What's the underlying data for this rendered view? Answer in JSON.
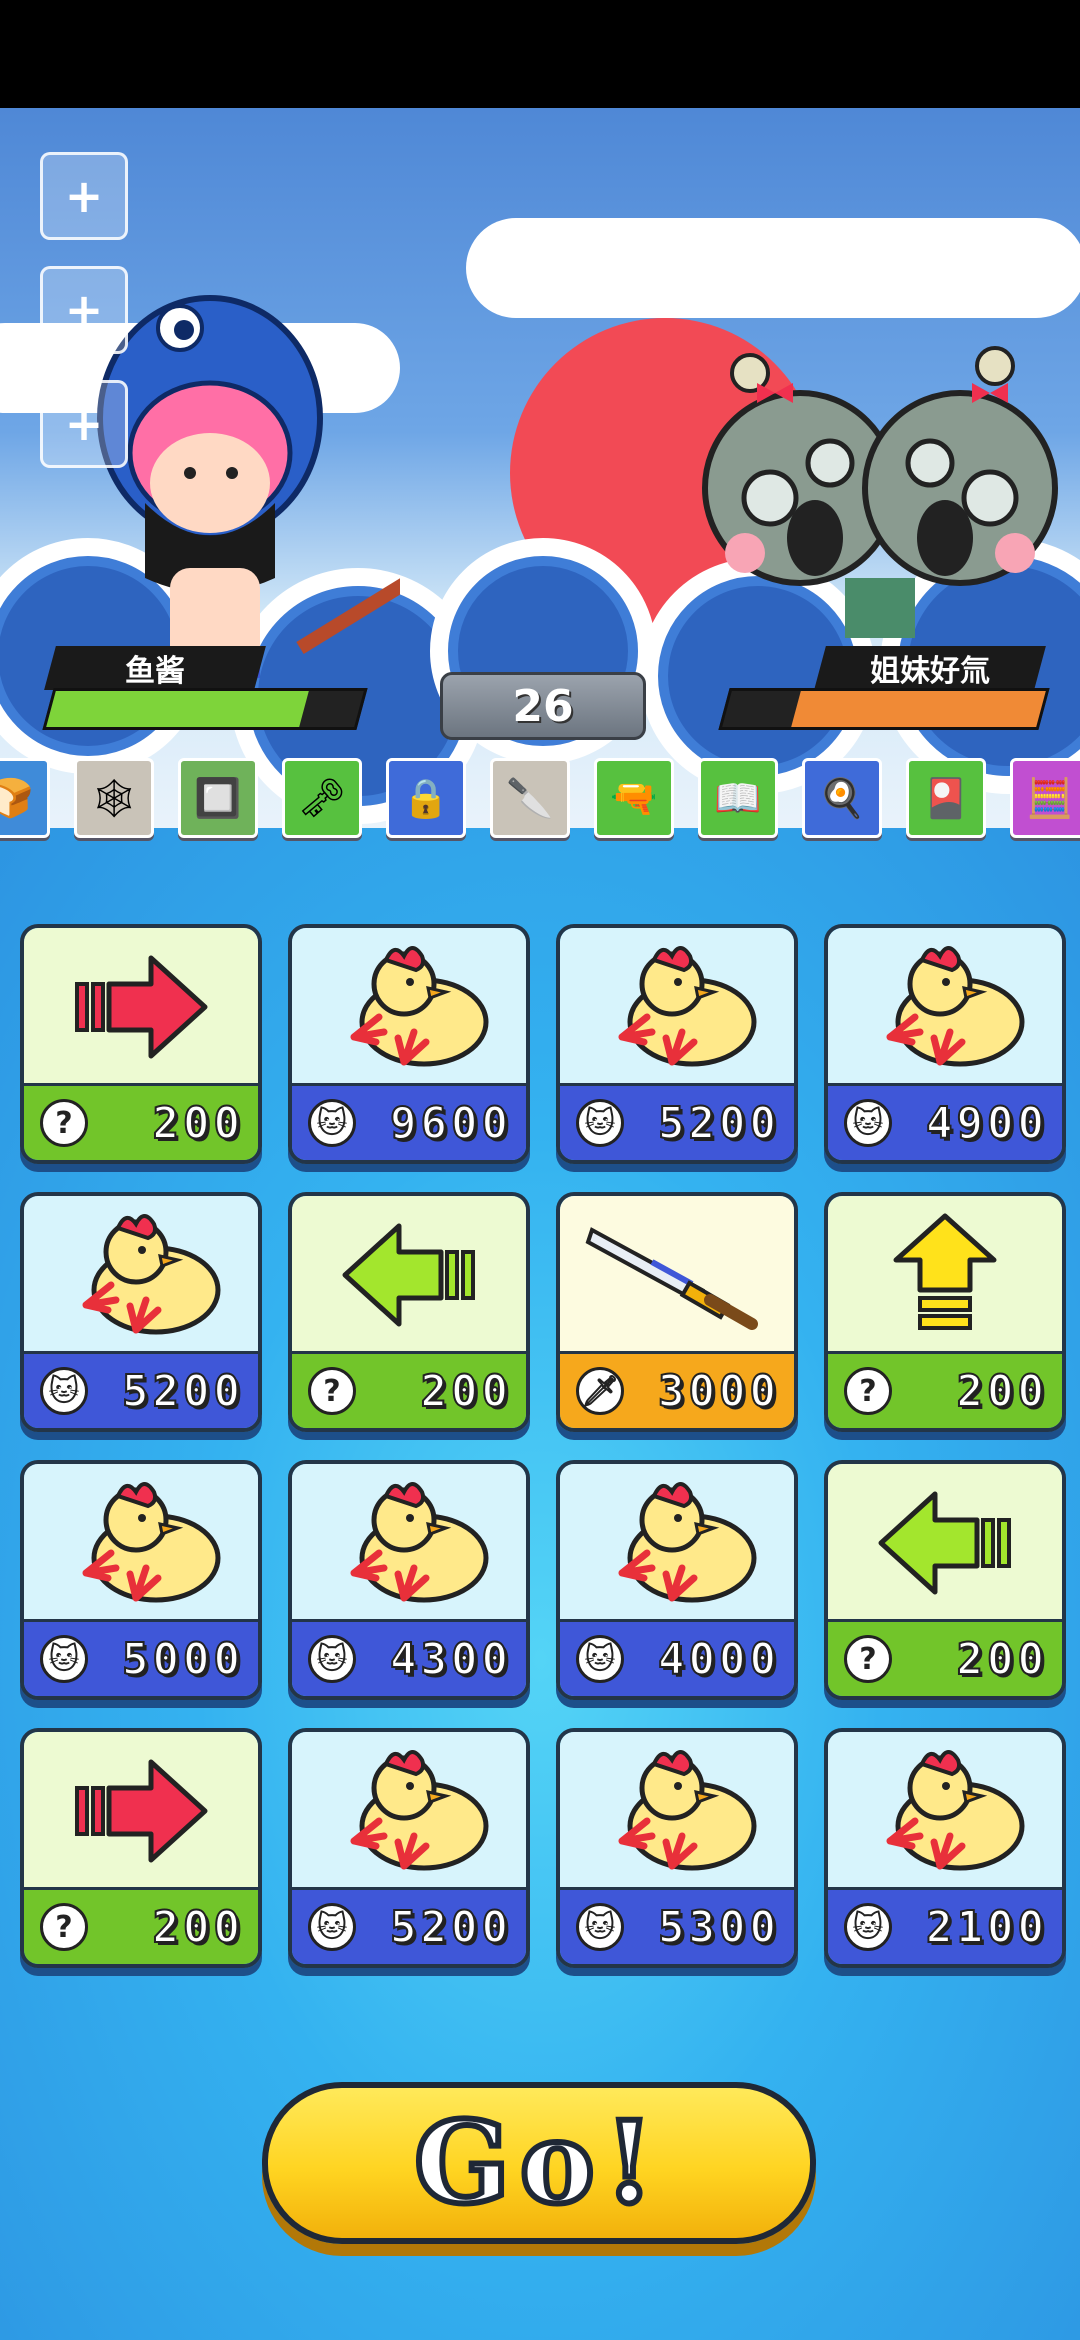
{
  "player": {
    "name": "鱼酱",
    "hp_fraction": 0.82
  },
  "enemy": {
    "name": "姐妹好氚",
    "hp_fraction": 0.78
  },
  "round": "26",
  "side_buttons": [
    "+",
    "+",
    "+"
  ],
  "item_strip": [
    {
      "icon": "bread-icon",
      "glyph": "🍞",
      "color": "#3f8bd9"
    },
    {
      "icon": "net-icon",
      "glyph": "🕸",
      "color": "#c9c3b8"
    },
    {
      "icon": "circuit-board-icon",
      "glyph": "🔲",
      "color": "#6fb25a"
    },
    {
      "icon": "key-icon",
      "glyph": "🗝",
      "color": "#57c13f"
    },
    {
      "icon": "safe-icon",
      "glyph": "🔒",
      "color": "#3f6bd9"
    },
    {
      "icon": "cleaver-icon",
      "glyph": "🔪",
      "color": "#c9c3b8"
    },
    {
      "icon": "gun-icon",
      "glyph": "🔫",
      "color": "#57c13f"
    },
    {
      "icon": "book-icon",
      "glyph": "📖",
      "color": "#57c13f"
    },
    {
      "icon": "frying-pan-icon",
      "glyph": "🍳",
      "color": "#3f6bd9"
    },
    {
      "icon": "card-icon",
      "glyph": "🎴",
      "color": "#57c13f"
    },
    {
      "icon": "calculator-icon",
      "glyph": "🧮",
      "color": "#c14fd1"
    }
  ],
  "cards": [
    {
      "type": "arrow-right",
      "theme": "green",
      "cost_icon": "?",
      "value": "200"
    },
    {
      "type": "chicken",
      "theme": "blue",
      "cost_icon": "cat",
      "value": "9600"
    },
    {
      "type": "chicken",
      "theme": "blue",
      "cost_icon": "cat",
      "value": "5200"
    },
    {
      "type": "chicken",
      "theme": "blue",
      "cost_icon": "cat",
      "value": "4900"
    },
    {
      "type": "chicken",
      "theme": "blue",
      "cost_icon": "cat",
      "value": "5200"
    },
    {
      "type": "arrow-left",
      "theme": "green",
      "cost_icon": "?",
      "value": "200"
    },
    {
      "type": "sword",
      "theme": "gold",
      "cost_icon": "sword",
      "value": "3000"
    },
    {
      "type": "arrow-up",
      "theme": "green",
      "cost_icon": "?",
      "value": "200"
    },
    {
      "type": "chicken",
      "theme": "blue",
      "cost_icon": "cat",
      "value": "5000"
    },
    {
      "type": "chicken",
      "theme": "blue",
      "cost_icon": "cat",
      "value": "4300"
    },
    {
      "type": "chicken",
      "theme": "blue",
      "cost_icon": "cat",
      "value": "4000"
    },
    {
      "type": "arrow-left",
      "theme": "green",
      "cost_icon": "?",
      "value": "200"
    },
    {
      "type": "arrow-right",
      "theme": "green",
      "cost_icon": "?",
      "value": "200"
    },
    {
      "type": "chicken",
      "theme": "blue",
      "cost_icon": "cat",
      "value": "5200"
    },
    {
      "type": "chicken",
      "theme": "blue",
      "cost_icon": "cat",
      "value": "5300"
    },
    {
      "type": "chicken",
      "theme": "blue",
      "cost_icon": "cat",
      "value": "2100"
    }
  ],
  "go_button": "Go!",
  "colors": {
    "player_hp": "#7ed43a",
    "enemy_hp": "#f08a36",
    "arrow_right": "#f0304f",
    "arrow_left": "#a3e62d",
    "arrow_up": "#ffe21b"
  }
}
